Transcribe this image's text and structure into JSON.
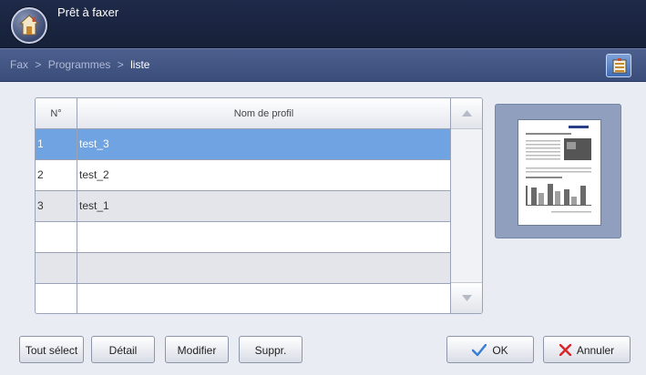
{
  "header": {
    "status": "Prêt à faxer",
    "home_icon": "home-icon"
  },
  "breadcrumb": {
    "items": [
      "Fax",
      "Programmes",
      "liste"
    ],
    "separator": ">"
  },
  "menu_icon": "menu-icon",
  "table": {
    "columns": [
      "N°",
      "Nom de profil"
    ],
    "rows": [
      {
        "num": "1",
        "name": "test_3",
        "selected": true
      },
      {
        "num": "2",
        "name": "test_2",
        "selected": false
      },
      {
        "num": "3",
        "name": "test_1",
        "selected": false
      },
      {
        "num": "",
        "name": "",
        "selected": false
      },
      {
        "num": "",
        "name": "",
        "selected": false
      },
      {
        "num": "",
        "name": "",
        "selected": false
      }
    ]
  },
  "buttons": {
    "select_all": "Tout sélect",
    "detail": "Détail",
    "modify": "Modifier",
    "delete": "Suppr.",
    "ok": "OK",
    "cancel": "Annuler"
  },
  "colors": {
    "selected_row": "#6fa3e2",
    "header_bg": "#1f2a4a",
    "ok_check": "#3a7fd6",
    "cancel_x": "#d8262b"
  }
}
